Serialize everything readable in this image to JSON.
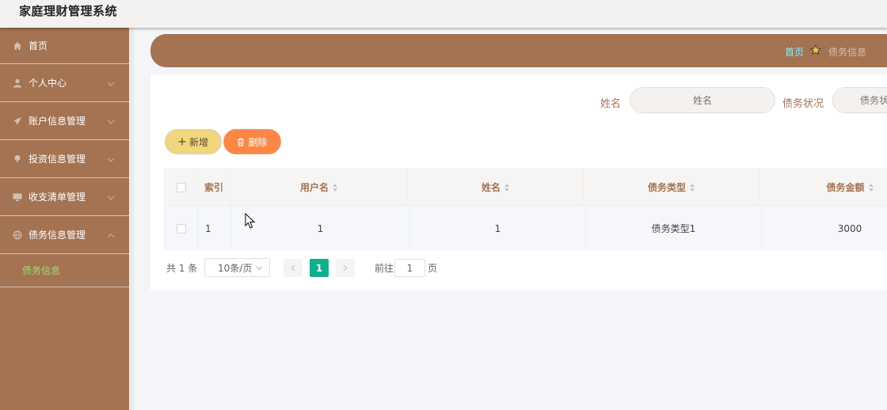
{
  "app": {
    "title": "家庭理财管理系统"
  },
  "sidebar": {
    "items": [
      {
        "label": "首页",
        "icon": "home-icon"
      },
      {
        "label": "个人中心",
        "icon": "user-icon"
      },
      {
        "label": "账户信息管理",
        "icon": "send-icon"
      },
      {
        "label": "投资信息管理",
        "icon": "pin-icon"
      },
      {
        "label": "收支清单管理",
        "icon": "monitor-icon"
      },
      {
        "label": "债务信息管理",
        "icon": "globe-icon"
      }
    ],
    "active_sub": {
      "label": "债务信息"
    }
  },
  "breadcrumb": {
    "home": "首页",
    "current": "债务信息"
  },
  "search": {
    "name_label": "姓名",
    "name_placeholder": "姓名",
    "status_label": "债务状况",
    "status_placeholder": "债务状况"
  },
  "toolbar": {
    "add_label": "新增",
    "delete_label": "删除"
  },
  "table": {
    "columns": [
      "索引",
      "用户名",
      "姓名",
      "债务类型",
      "债务金额"
    ],
    "rows": [
      {
        "index": "1",
        "username": "1",
        "name": "1",
        "debt_type": "债务类型1",
        "amount": "3000"
      }
    ]
  },
  "pagination": {
    "total_text": "共 1 条",
    "page_size": "10条/页",
    "current_page": "1",
    "goto_prefix": "前往",
    "goto_value": "1",
    "goto_suffix": "页"
  },
  "colors": {
    "sidebar_bg": "#a37352",
    "active_sub": "#8fe36a",
    "breadcrumb_home": "#8fe8ff",
    "add_button": "#f0d77d",
    "delete_button": "#fb8746",
    "current_page": "#13ae8b"
  }
}
